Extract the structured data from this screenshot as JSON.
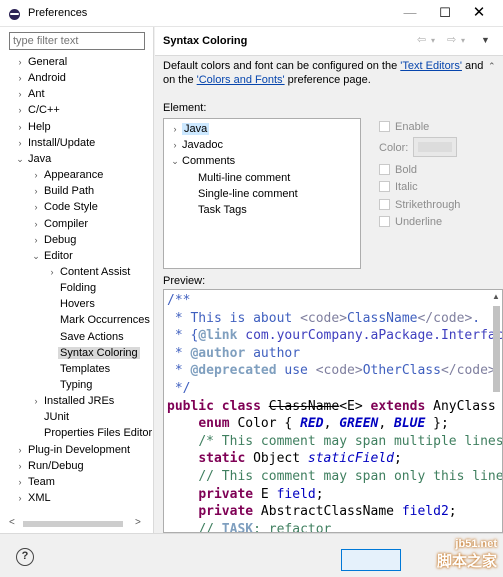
{
  "window": {
    "title": "Preferences",
    "icons": {
      "app": "eclipse-icon",
      "minimize": "minimize-icon",
      "maximize": "maximize-icon",
      "close": "close-icon"
    }
  },
  "sidebar": {
    "filter_placeholder": "type filter text",
    "items": [
      {
        "label": "General",
        "expander": ">",
        "level": 0
      },
      {
        "label": "Android",
        "expander": ">",
        "level": 0
      },
      {
        "label": "Ant",
        "expander": ">",
        "level": 0
      },
      {
        "label": "C/C++",
        "expander": ">",
        "level": 0
      },
      {
        "label": "Help",
        "expander": ">",
        "level": 0
      },
      {
        "label": "Install/Update",
        "expander": ">",
        "level": 0
      },
      {
        "label": "Java",
        "expander": "v",
        "level": 0
      },
      {
        "label": "Appearance",
        "expander": ">",
        "level": 1
      },
      {
        "label": "Build Path",
        "expander": ">",
        "level": 1
      },
      {
        "label": "Code Style",
        "expander": ">",
        "level": 1
      },
      {
        "label": "Compiler",
        "expander": ">",
        "level": 1
      },
      {
        "label": "Debug",
        "expander": ">",
        "level": 1
      },
      {
        "label": "Editor",
        "expander": "v",
        "level": 1
      },
      {
        "label": "Content Assist",
        "expander": ">",
        "level": 2
      },
      {
        "label": "Folding",
        "expander": "",
        "level": 2
      },
      {
        "label": "Hovers",
        "expander": "",
        "level": 2
      },
      {
        "label": "Mark Occurrences",
        "expander": "",
        "level": 2
      },
      {
        "label": "Save Actions",
        "expander": "",
        "level": 2
      },
      {
        "label": "Syntax Coloring",
        "expander": "",
        "level": 2,
        "selected": true
      },
      {
        "label": "Templates",
        "expander": "",
        "level": 2
      },
      {
        "label": "Typing",
        "expander": "",
        "level": 2
      },
      {
        "label": "Installed JREs",
        "expander": ">",
        "level": 1
      },
      {
        "label": "JUnit",
        "expander": "",
        "level": 1
      },
      {
        "label": "Properties Files Editor",
        "expander": "",
        "level": 1
      },
      {
        "label": "Plug-in Development",
        "expander": ">",
        "level": 0
      },
      {
        "label": "Run/Debug",
        "expander": ">",
        "level": 0
      },
      {
        "label": "Team",
        "expander": ">",
        "level": 0
      },
      {
        "label": "XML",
        "expander": ">",
        "level": 0
      }
    ]
  },
  "page": {
    "title": "Syntax Coloring",
    "description_prefix": "Default colors and font can be configured on the ",
    "link_text_editors": "'Text Editors'",
    "description_mid1": " and",
    "description_mid2": "on the ",
    "link_colors_fonts": "'Colors and Fonts'",
    "description_suffix": " preference page.",
    "element_label": "Element:",
    "elements": [
      {
        "label": "Java",
        "expander": ">",
        "level": 0,
        "selected": true
      },
      {
        "label": "Javadoc",
        "expander": ">",
        "level": 0
      },
      {
        "label": "Comments",
        "expander": "v",
        "level": 0
      },
      {
        "label": "Multi-line comment",
        "expander": "",
        "level": 1
      },
      {
        "label": "Single-line comment",
        "expander": "",
        "level": 1
      },
      {
        "label": "Task Tags",
        "expander": "",
        "level": 1
      }
    ],
    "options": {
      "enable": "Enable",
      "color": "Color:",
      "bold": "Bold",
      "italic": "Italic",
      "strikethrough": "Strikethrough",
      "underline": "Underline"
    },
    "preview_label": "Preview:"
  },
  "footer": {
    "help_icon": "help-icon",
    "help_glyph": "?"
  },
  "watermark": {
    "line1": "jb51.net",
    "line2": "脚本之家"
  }
}
